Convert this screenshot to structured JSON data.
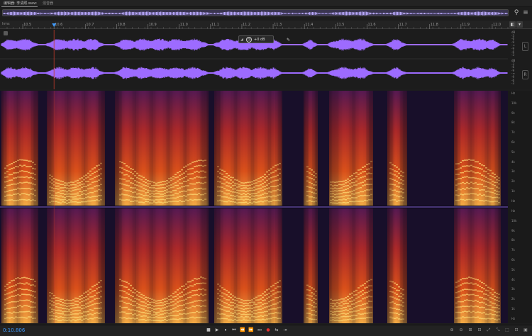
{
  "tabs": {
    "editor": "编辑器: 李清照.wav",
    "close": "≡",
    "mixer": "混音器"
  },
  "ruler": {
    "unit": "hms",
    "labels": [
      "10.5",
      "10.6",
      "10.7",
      "10.8",
      "10.9",
      "11.0",
      "11.1",
      "11.2",
      "11.3",
      "11.4",
      "11.5",
      "11.6",
      "11.7",
      "11.8",
      "11.9",
      "12.0"
    ],
    "start": 10.45,
    "end": 12.05,
    "playhead": 10.6
  },
  "waveform": {
    "amp_labels_top": [
      "dB",
      "-3",
      "-6",
      "-9",
      "-∞",
      "-9",
      "-6",
      "-3"
    ],
    "amp_labels_bottom": [
      "dB",
      "-3",
      "-6",
      "-9",
      "-∞",
      "-9",
      "-6",
      "-3"
    ],
    "channels": [
      "L",
      "R"
    ],
    "hud_value": "+0 dB",
    "color": "#9d6bff"
  },
  "spectral": {
    "hz_labels_top": [
      "Hz",
      "10k",
      "9k",
      "8k",
      "7k",
      "6k",
      "5k",
      "4k",
      "3k",
      "2k",
      "1k",
      "Hz"
    ],
    "hz_labels_bottom": [
      "Hz",
      "10k",
      "9k",
      "8k",
      "7k",
      "6k",
      "5k",
      "4k",
      "3k",
      "2k",
      "1k",
      "Hz"
    ]
  },
  "status": {
    "time": "0:10.806"
  },
  "colors": {
    "accent": "#3f9cff",
    "wave": "#9d6bff"
  }
}
